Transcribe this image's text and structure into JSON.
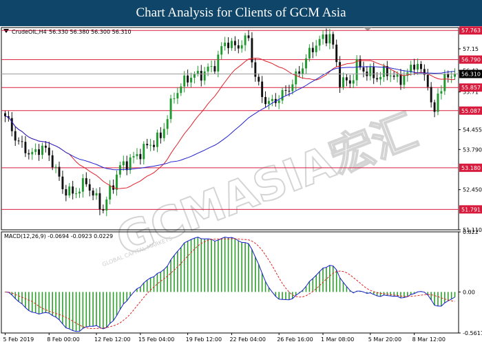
{
  "header": {
    "title": "Chart Analysis for Clients of GCM Asia"
  },
  "watermark": {
    "text": "GCMASIA宏汇",
    "subtext": "GLOBAL CAPITAL MARKETS"
  },
  "chart_data": [
    {
      "type": "candlestick",
      "symbol_label": "CrudeOIL,H4",
      "ohlc_label": "56.330 56.380 56.300 56.310",
      "current_price": 56.31,
      "current_price_label": "56.310",
      "ylim": [
        51.11,
        57.86
      ],
      "y_ticks": [
        57.15,
        56.43,
        55.71,
        54.45,
        53.79,
        52.45,
        51.11
      ],
      "y_tick_labels": [
        "57.15",
        "56.43",
        "55.71",
        "54.455",
        "53.790",
        "52.450",
        "51.110"
      ],
      "levels": [
        {
          "value": 57.763,
          "label": "57.763"
        },
        {
          "value": 56.79,
          "label": "56.790"
        },
        {
          "value": 55.857,
          "label": "55.857"
        },
        {
          "value": 55.087,
          "label": "55.087"
        },
        {
          "value": 53.18,
          "label": "53.180"
        },
        {
          "value": 51.791,
          "label": "51.791"
        }
      ],
      "close_anchors": [
        [
          0,
          54.9
        ],
        [
          4,
          54.0
        ],
        [
          8,
          53.6
        ],
        [
          11,
          53.9
        ],
        [
          14,
          53.4
        ],
        [
          17,
          52.5
        ],
        [
          20,
          52.3
        ],
        [
          24,
          52.7
        ],
        [
          27,
          52.1
        ],
        [
          29,
          51.8
        ],
        [
          31,
          52.4
        ],
        [
          34,
          53.2
        ],
        [
          38,
          53.5
        ],
        [
          42,
          53.9
        ],
        [
          46,
          54.2
        ],
        [
          50,
          55.6
        ],
        [
          54,
          56.2
        ],
        [
          58,
          56.3
        ],
        [
          62,
          56.6
        ],
        [
          65,
          57.4
        ],
        [
          68,
          57.2
        ],
        [
          72,
          57.5
        ],
        [
          74,
          56.2
        ],
        [
          76,
          55.6
        ],
        [
          78,
          55.3
        ],
        [
          82,
          55.6
        ],
        [
          85,
          56.0
        ],
        [
          88,
          56.6
        ],
        [
          91,
          57.2
        ],
        [
          94,
          57.5
        ],
        [
          96,
          57.6
        ],
        [
          97,
          57.2
        ],
        [
          99,
          56.1
        ],
        [
          102,
          56.0
        ],
        [
          104,
          56.6
        ],
        [
          108,
          56.3
        ],
        [
          110,
          56.2
        ],
        [
          113,
          56.4
        ],
        [
          116,
          56.1
        ],
        [
          119,
          56.3
        ],
        [
          121,
          56.7
        ],
        [
          123,
          56.4
        ],
        [
          125,
          56.1
        ],
        [
          126,
          55.2
        ],
        [
          127,
          55.0
        ],
        [
          128,
          55.7
        ],
        [
          130,
          56.1
        ],
        [
          132,
          56.31
        ]
      ],
      "moving_averages": [
        {
          "period": 20,
          "color": "#e0202a"
        },
        {
          "period": 50,
          "color": "#2020d0"
        }
      ],
      "x_ticks": [
        {
          "index": 0,
          "label": "5 Feb 2019"
        },
        {
          "index": 13,
          "label": "8 Feb 00:00"
        },
        {
          "index": 27,
          "label": "12 Feb 12:00"
        },
        {
          "index": 40,
          "label": "15 Feb 04:00"
        },
        {
          "index": 54,
          "label": "19 Feb 12:00"
        },
        {
          "index": 67,
          "label": "22 Feb 04:00"
        },
        {
          "index": 81,
          "label": "26 Feb 16:00"
        },
        {
          "index": 94,
          "label": "1 Mar 08:00"
        },
        {
          "index": 108,
          "label": "5 Mar 20:00"
        },
        {
          "index": 121,
          "label": "8 Mar 12:00"
        }
      ],
      "bull_color": "#1f9a2e",
      "bear_color": "#101010"
    },
    {
      "type": "macd",
      "label": "MACD(12,26,9) -0.0694 -0.0923 0.0229",
      "params": [
        12,
        26,
        9
      ],
      "ylim": [
        -0.5611,
        0.822
      ],
      "y_ticks": [
        0.822,
        0.0,
        -0.5611
      ],
      "y_tick_labels": [
        "0.822",
        "0.00",
        "-0.5611"
      ],
      "macd_color": "#1a1ad0",
      "signal_color": "#e02020",
      "histogram_color": "#2aa02a"
    }
  ]
}
